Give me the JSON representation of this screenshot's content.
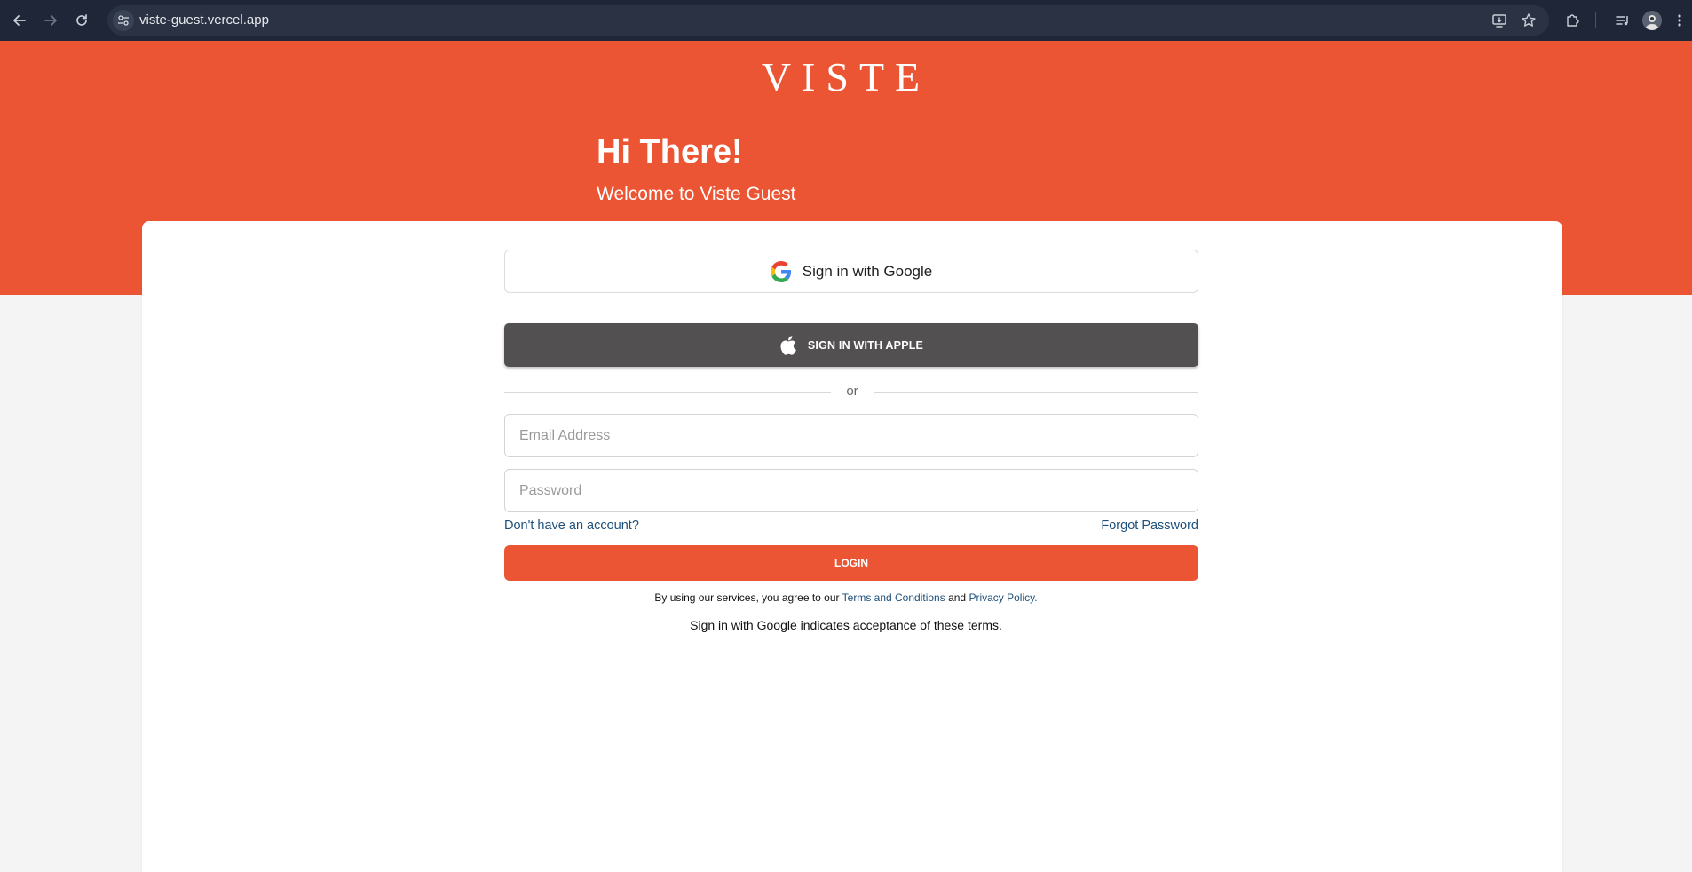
{
  "browser": {
    "url": "viste-guest.vercel.app",
    "icons": {
      "back": "arrow-left-icon",
      "forward": "arrow-right-icon",
      "reload": "reload-icon",
      "site_info": "tune-icon",
      "install": "install-app-icon",
      "bookmark": "star-icon",
      "extensions": "puzzle-icon",
      "media": "media-queue-icon",
      "profile": "avatar",
      "menu": "kebab-menu-icon"
    }
  },
  "colors": {
    "brand": "#ec5533",
    "apple_button": "#525050",
    "link": "#1d4f7a"
  },
  "header": {
    "logo": "VISTE",
    "greeting": "Hi There!",
    "subtitle": "Welcome to Viste Guest"
  },
  "auth": {
    "google_label": "Sign in with Google",
    "apple_label": "SIGN IN WITH APPLE",
    "divider": "or",
    "email_placeholder": "Email Address",
    "email_value": "",
    "password_placeholder": "Password",
    "password_value": "",
    "signup_link": "Don't have an account?",
    "forgot_link": "Forgot Password",
    "login_label": "LOGIN"
  },
  "legal": {
    "prefix": "By using our services, you agree to our",
    "terms": "Terms and Conditions",
    "and": "and",
    "privacy": "Privacy Policy.",
    "google_note": "Sign in with Google indicates acceptance of these terms."
  }
}
